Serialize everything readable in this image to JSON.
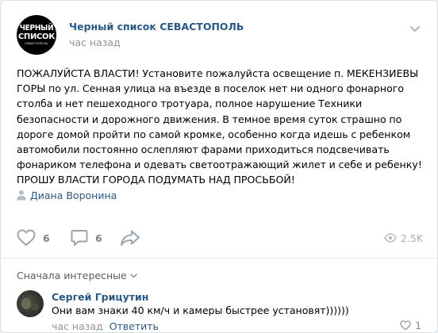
{
  "post": {
    "avatar_lines": [
      "ЧЕРНЫЙ",
      "СПИСОК",
      "СЕВАСТОПОЛЬ"
    ],
    "author": "Черный список СЕВАСТОПОЛЬ",
    "time": "час назад",
    "text": "ПОЖАЛУЙСТА ВЛАСТИ! Установите пожалуйста освещение п. МЕКЕНЗИЕВЫ ГОРЫ по ул. Сенная улица на въезде в поселок нет ни одного фонарного столба и нет пешеходного тротуара, полное нарушение Техники безопасности и дорожного движения. В темное время суток страшно по дороге домой пройти по самой кромке, особенно когда идешь с ребенком автомобили постоянно ослепляют фарами приходиться подсвечивать фонариком телефона и одевать светоотражающий жилет и себе и ребенку! ПРОШУ ВЛАСТИ ГОРОДА ПОДУМАТЬ НАД ПРОСЬБОЙ!",
    "signer": "Диана Воронина",
    "likes": "6",
    "comments": "6",
    "views": "2.5K"
  },
  "comments_section": {
    "sort_label": "Сначала интересные",
    "items": [
      {
        "name": "Сергей Грицутин",
        "text": "Они вам знаки 40 км/ч и камеры быстрее установят))))))",
        "time": "час назад",
        "reply_label": "Ответить",
        "likes": "1"
      }
    ]
  },
  "colors": {
    "link": "#2a5885",
    "muted": "#939393",
    "icon": "#99a2ad"
  }
}
